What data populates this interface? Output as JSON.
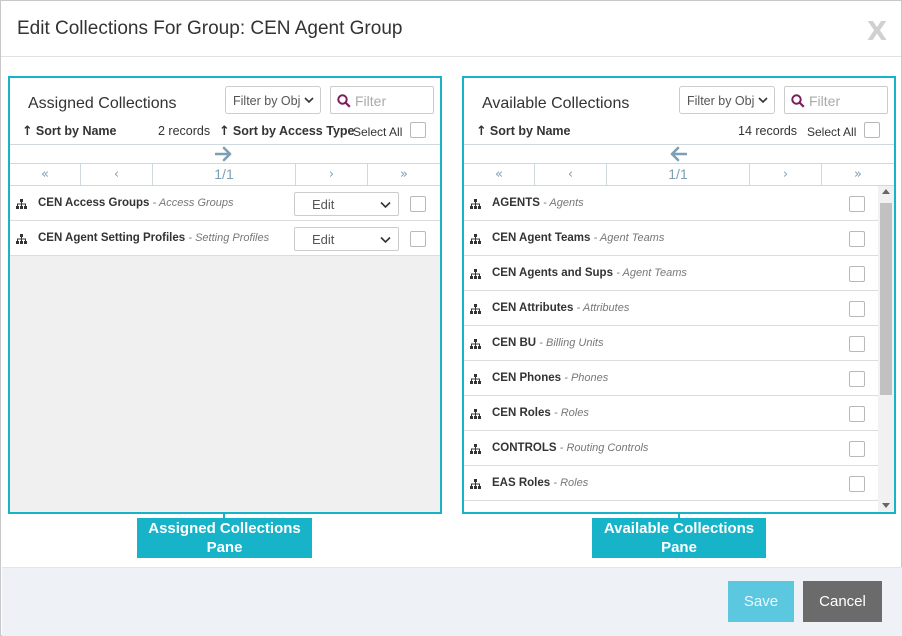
{
  "dialog": {
    "title": "Edit Collections For Group: CEN Agent Group",
    "close_label": "X"
  },
  "assigned": {
    "title": "Assigned Collections",
    "filter_select": "Filter by Obj",
    "filter_placeholder": "Filter",
    "sort_name": "Sort by Name",
    "records": "2 records",
    "sort_access": "Sort by Access Type",
    "select_all": "Select All",
    "pager": {
      "first": "«",
      "prev": "‹",
      "page": "1/1",
      "next": "›",
      "last": "»"
    },
    "rows": [
      {
        "name": "CEN Access Groups",
        "type": "- Access Groups",
        "access": "Edit"
      },
      {
        "name": "CEN Agent Setting Profiles",
        "type": "- Setting Profiles",
        "access": "Edit"
      }
    ]
  },
  "available": {
    "title": "Available Collections",
    "filter_select": "Filter by Obj",
    "filter_placeholder": "Filter",
    "sort_name": "Sort by Name",
    "records": "14 records",
    "select_all": "Select All",
    "pager": {
      "first": "«",
      "prev": "‹",
      "page": "1/1",
      "next": "›",
      "last": "»"
    },
    "rows": [
      {
        "name": "AGENTS",
        "type": "- Agents"
      },
      {
        "name": "CEN Agent Teams",
        "type": "- Agent Teams"
      },
      {
        "name": "CEN Agents and Sups",
        "type": "- Agent Teams"
      },
      {
        "name": "CEN Attributes",
        "type": "- Attributes"
      },
      {
        "name": "CEN BU",
        "type": "- Billing Units"
      },
      {
        "name": "CEN Phones",
        "type": "- Phones"
      },
      {
        "name": "CEN Roles",
        "type": "- Roles"
      },
      {
        "name": "CONTROLS",
        "type": "- Routing Controls"
      },
      {
        "name": "EAS Roles",
        "type": "- Roles"
      }
    ]
  },
  "callouts": {
    "assigned_line1": "Assigned Collections",
    "assigned_line2": "Pane",
    "available_line1": "Available Collections",
    "available_line2": "Pane"
  },
  "footer": {
    "save_label": "Save",
    "cancel_label": "Cancel"
  },
  "icons": {
    "collection": "hierarchy-icon",
    "search": "magnifier-icon",
    "move_right": "arrow-right-icon",
    "move_left": "arrow-left-icon"
  },
  "colors": {
    "accent": "#16b3c9",
    "search_icon": "#7a1f5c",
    "pager": "#7d9fb5",
    "save_bg": "#5cc8e0",
    "cancel_bg": "#6b6b6b"
  }
}
